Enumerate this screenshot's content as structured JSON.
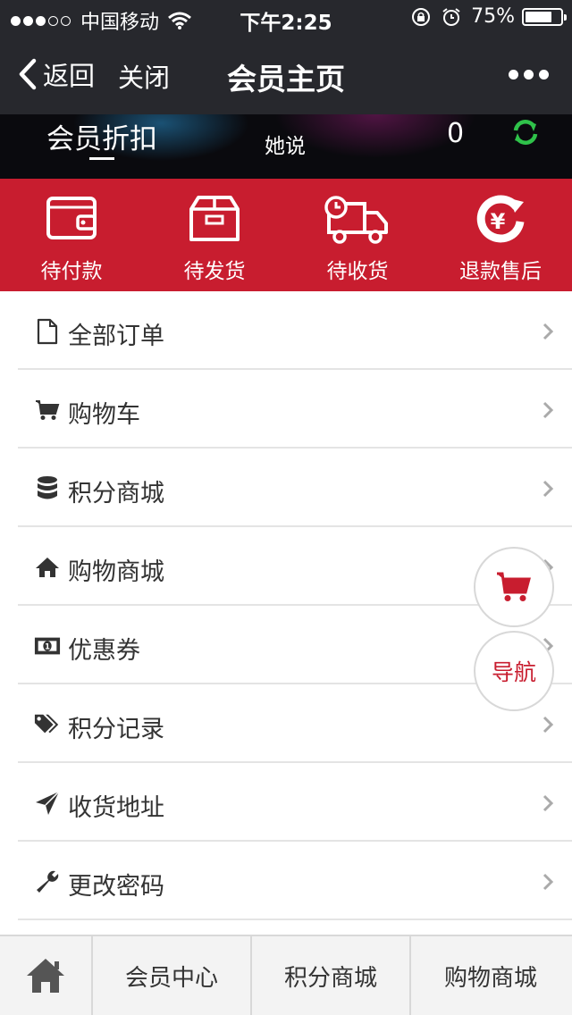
{
  "status_bar": {
    "carrier": "中国移动",
    "time": "下午2:25",
    "battery_percent": "75%",
    "battery_level": 0.75
  },
  "navbar": {
    "back_label": "返回",
    "close_label": "关闭",
    "title": "会员主页"
  },
  "hero": {
    "discount_label": "会员折扣",
    "name": "她说",
    "count": "0"
  },
  "order_status": [
    {
      "label": "待付款",
      "icon": "wallet-icon"
    },
    {
      "label": "待发货",
      "icon": "box-icon"
    },
    {
      "label": "待收货",
      "icon": "delivery-truck-icon"
    },
    {
      "label": "退款售后",
      "icon": "refund-yen-icon"
    }
  ],
  "menu": [
    {
      "label": "全部订单",
      "icon": "document-icon"
    },
    {
      "label": "购物车",
      "icon": "cart-icon"
    },
    {
      "label": "积分商城",
      "icon": "database-icon"
    },
    {
      "label": "购物商城",
      "icon": "home-icon"
    },
    {
      "label": "优惠券",
      "icon": "money-icon"
    },
    {
      "label": "积分记录",
      "icon": "tags-icon"
    },
    {
      "label": "收货地址",
      "icon": "paper-plane-icon"
    },
    {
      "label": "更改密码",
      "icon": "wrench-icon"
    }
  ],
  "float_buttons": {
    "cart_icon": "cart-icon",
    "nav_label": "导航"
  },
  "tabbar": {
    "home_icon": "home-icon",
    "tabs": [
      "会员中心",
      "积分商城",
      "购物商城"
    ]
  },
  "colors": {
    "header_bg": "#27282d",
    "accent_red": "#c81d2f",
    "refresh_green": "#2fc24a",
    "divider": "#e4e4e4"
  }
}
